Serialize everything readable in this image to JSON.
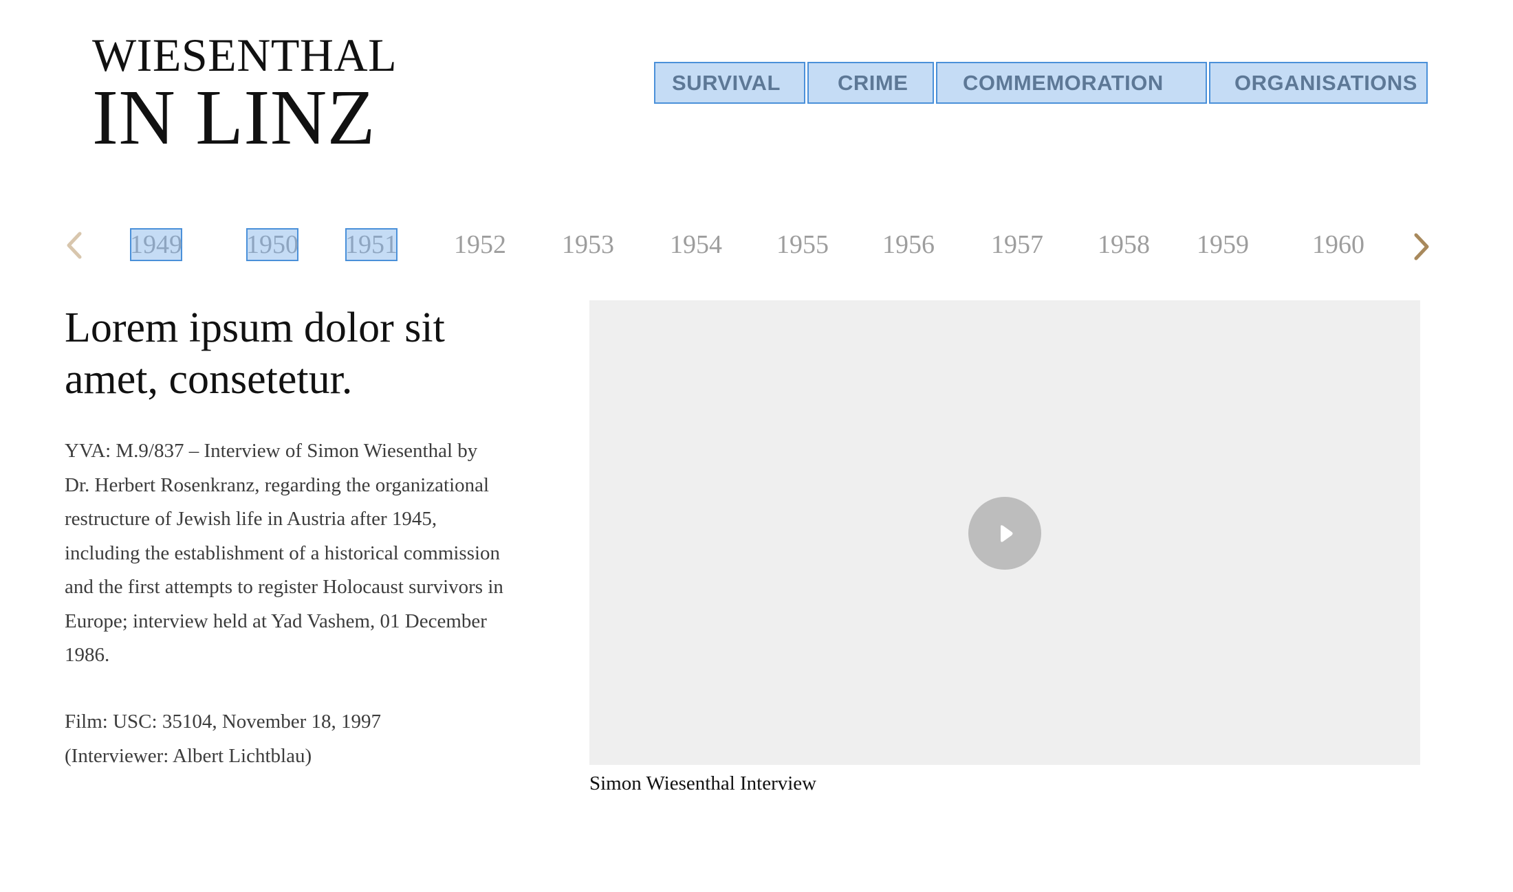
{
  "logo": {
    "line1": "WIESENTHAL",
    "line2": "IN LINZ"
  },
  "nav": {
    "items": [
      {
        "label": "SURVIVAL"
      },
      {
        "label": "CRIME"
      },
      {
        "label": "COMMEMORATION"
      },
      {
        "label": "ORGANISATIONS"
      }
    ]
  },
  "timeline": {
    "prev_icon": "chevron-left-icon",
    "next_icon": "chevron-right-icon",
    "years": [
      {
        "label": "1949",
        "selected": true
      },
      {
        "label": "1950",
        "selected": true
      },
      {
        "label": "1951",
        "selected": true
      },
      {
        "label": "1952",
        "selected": false
      },
      {
        "label": "1953",
        "selected": false
      },
      {
        "label": "1954",
        "selected": false
      },
      {
        "label": "1955",
        "selected": false
      },
      {
        "label": "1956",
        "selected": false
      },
      {
        "label": "1957",
        "selected": false
      },
      {
        "label": "1958",
        "selected": false
      },
      {
        "label": "1959",
        "selected": false
      },
      {
        "label": "1960",
        "selected": false
      }
    ]
  },
  "content": {
    "headline": "Lorem ipsum dolor sit amet, consetetur.",
    "description": "YVA: M.9/837 – Interview of Simon Wiesenthal by Dr. Herbert Rosenkranz, regarding the organizational restructure of Jewish life in Austria after 1945, including the establishment of a historical commission and the first attempts to register Holocaust survivors in Europe; interview held at Yad Vashem, 01 December 1986.",
    "film_line1": "Film: USC: 35104, November 18, 1997",
    "film_line2": "(Interviewer: Albert Lichtblau)"
  },
  "video": {
    "play_icon": "play-icon",
    "caption": "Simon Wiesenthal Interview"
  },
  "colors": {
    "nav_bg": "#c5dcf5",
    "nav_border": "#4a90d9",
    "nav_text": "#5d7896",
    "year_text": "#9d9d9d",
    "arrow_left": "#d8c6ad",
    "arrow_right": "#a8895c",
    "video_bg": "#efefef",
    "play_bg": "#bdbdbd"
  }
}
